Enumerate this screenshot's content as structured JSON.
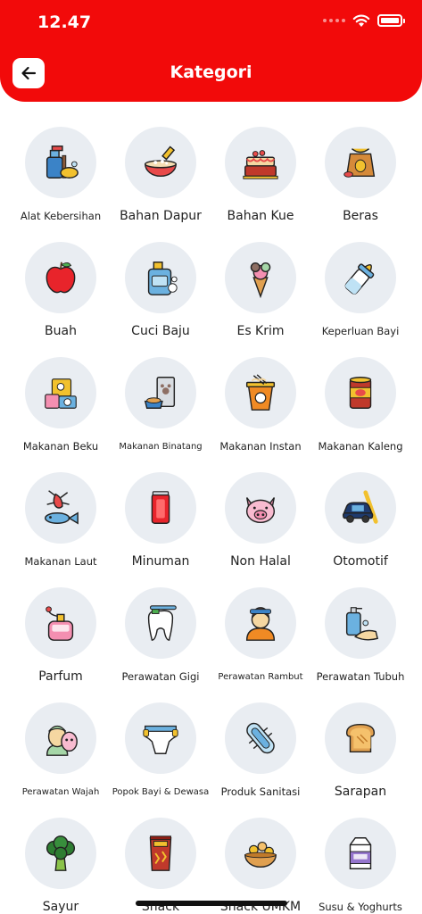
{
  "status_bar": {
    "time": "12.47"
  },
  "header": {
    "title": "Kategori",
    "back_icon": "arrow-left-icon",
    "background": "#f20a0a"
  },
  "categories": [
    {
      "label": "Alat Kebersihan",
      "icon": "cleaning-tools-icon"
    },
    {
      "label": "Bahan Dapur",
      "icon": "kitchen-bowl-icon"
    },
    {
      "label": "Bahan Kue",
      "icon": "cake-icon"
    },
    {
      "label": "Beras",
      "icon": "rice-sack-icon"
    },
    {
      "label": "Buah",
      "icon": "apple-icon"
    },
    {
      "label": "Cuci Baju",
      "icon": "detergent-icon"
    },
    {
      "label": "Es Krim",
      "icon": "ice-cream-icon"
    },
    {
      "label": "Keperluan Bayi",
      "icon": "baby-bottle-icon"
    },
    {
      "label": "Makanan Beku",
      "icon": "frozen-food-icon"
    },
    {
      "label": "Makanan Binatang",
      "icon": "pet-food-icon"
    },
    {
      "label": "Makanan Instan",
      "icon": "instant-noodle-icon"
    },
    {
      "label": "Makanan Kaleng",
      "icon": "canned-food-icon"
    },
    {
      "label": "Makanan Laut",
      "icon": "seafood-icon"
    },
    {
      "label": "Minuman",
      "icon": "soda-can-icon"
    },
    {
      "label": "Non Halal",
      "icon": "pig-icon"
    },
    {
      "label": "Otomotif",
      "icon": "car-wrench-icon"
    },
    {
      "label": "Parfum",
      "icon": "perfume-icon"
    },
    {
      "label": "Perawatan Gigi",
      "icon": "tooth-icon"
    },
    {
      "label": "Perawatan Rambut",
      "icon": "hair-care-icon"
    },
    {
      "label": "Perawatan Tubuh",
      "icon": "body-soap-icon"
    },
    {
      "label": "Perawatan Wajah",
      "icon": "face-mask-icon"
    },
    {
      "label": "Popok Bayi & Dewasa",
      "icon": "diaper-icon"
    },
    {
      "label": "Produk Sanitasi",
      "icon": "sanitary-pad-icon"
    },
    {
      "label": "Sarapan",
      "icon": "toast-icon"
    },
    {
      "label": "Sayur",
      "icon": "broccoli-icon"
    },
    {
      "label": "Snack",
      "icon": "snack-bag-icon"
    },
    {
      "label": "Snack UMKM",
      "icon": "snack-bowl-icon"
    },
    {
      "label": "Susu & Yoghurts",
      "icon": "milk-carton-icon"
    }
  ]
}
